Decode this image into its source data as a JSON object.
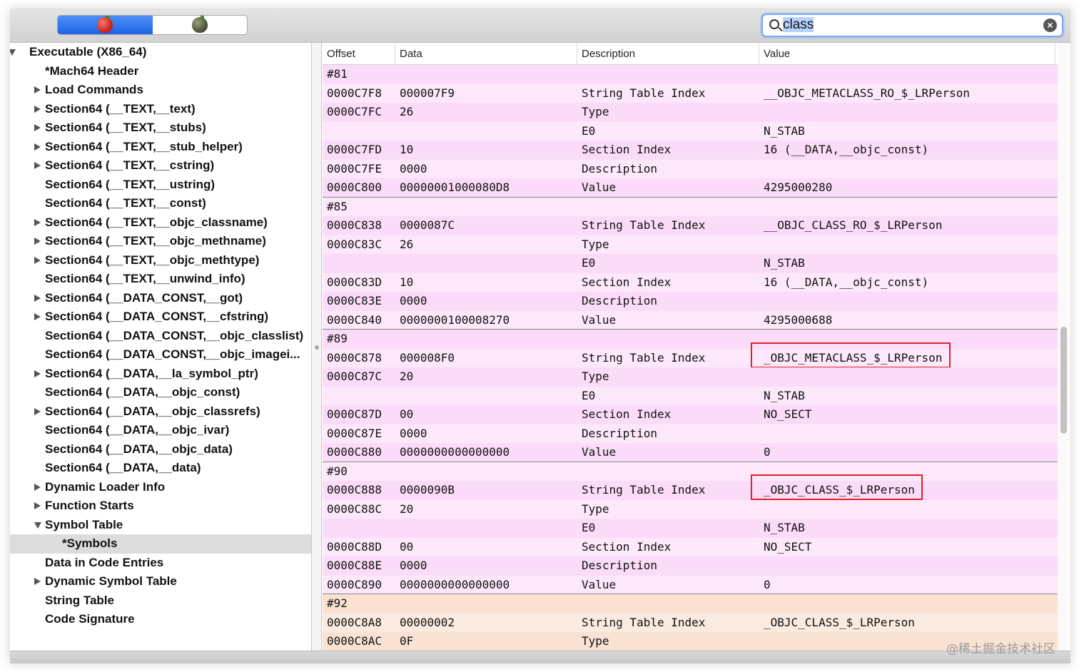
{
  "search": {
    "value": "class"
  },
  "sidebar": {
    "items": [
      {
        "label": "Executable  (X86_64)",
        "level": 0,
        "toggle": "down"
      },
      {
        "label": "*Mach64 Header",
        "level": 1,
        "toggle": "none"
      },
      {
        "label": "Load Commands",
        "level": 1,
        "toggle": "right"
      },
      {
        "label": "Section64 (__TEXT,__text)",
        "level": 1,
        "toggle": "right"
      },
      {
        "label": "Section64 (__TEXT,__stubs)",
        "level": 1,
        "toggle": "right"
      },
      {
        "label": "Section64 (__TEXT,__stub_helper)",
        "level": 1,
        "toggle": "right"
      },
      {
        "label": "Section64 (__TEXT,__cstring)",
        "level": 1,
        "toggle": "right"
      },
      {
        "label": "Section64 (__TEXT,__ustring)",
        "level": 1,
        "toggle": "none"
      },
      {
        "label": "Section64 (__TEXT,__const)",
        "level": 1,
        "toggle": "none"
      },
      {
        "label": "Section64 (__TEXT,__objc_classname)",
        "level": 1,
        "toggle": "right"
      },
      {
        "label": "Section64 (__TEXT,__objc_methname)",
        "level": 1,
        "toggle": "right"
      },
      {
        "label": "Section64 (__TEXT,__objc_methtype)",
        "level": 1,
        "toggle": "right"
      },
      {
        "label": "Section64 (__TEXT,__unwind_info)",
        "level": 1,
        "toggle": "none"
      },
      {
        "label": "Section64 (__DATA_CONST,__got)",
        "level": 1,
        "toggle": "right"
      },
      {
        "label": "Section64 (__DATA_CONST,__cfstring)",
        "level": 1,
        "toggle": "right"
      },
      {
        "label": "Section64 (__DATA_CONST,__objc_classlist)",
        "level": 1,
        "toggle": "none"
      },
      {
        "label": "Section64 (__DATA_CONST,__objc_imagei...",
        "level": 1,
        "toggle": "none"
      },
      {
        "label": "Section64 (__DATA,__la_symbol_ptr)",
        "level": 1,
        "toggle": "right"
      },
      {
        "label": "Section64 (__DATA,__objc_const)",
        "level": 1,
        "toggle": "none"
      },
      {
        "label": "Section64 (__DATA,__objc_classrefs)",
        "level": 1,
        "toggle": "right"
      },
      {
        "label": "Section64 (__DATA,__objc_ivar)",
        "level": 1,
        "toggle": "none"
      },
      {
        "label": "Section64 (__DATA,__objc_data)",
        "level": 1,
        "toggle": "none"
      },
      {
        "label": "Section64 (__DATA,__data)",
        "level": 1,
        "toggle": "none"
      },
      {
        "label": "Dynamic Loader Info",
        "level": 1,
        "toggle": "right"
      },
      {
        "label": "Function Starts",
        "level": 1,
        "toggle": "right"
      },
      {
        "label": "Symbol Table",
        "level": 1,
        "toggle": "down"
      },
      {
        "label": "*Symbols",
        "level": 2,
        "toggle": "none",
        "selected": true
      },
      {
        "label": "Data in Code Entries",
        "level": 1,
        "toggle": "none"
      },
      {
        "label": "Dynamic Symbol Table",
        "level": 1,
        "toggle": "right"
      },
      {
        "label": "String Table",
        "level": 1,
        "toggle": "none"
      },
      {
        "label": "Code Signature",
        "level": 1,
        "toggle": "none"
      }
    ]
  },
  "table": {
    "columns": [
      "Offset",
      "Data",
      "Description",
      "Value"
    ],
    "rows": [
      {
        "offset": "#81",
        "data": "",
        "desc": "",
        "value": "",
        "tone": "pink"
      },
      {
        "offset": "0000C7F8",
        "data": "000007F9",
        "desc": "String Table Index",
        "value": "__OBJC_METACLASS_RO_$_LRPerson",
        "tone": "pink"
      },
      {
        "offset": "0000C7FC",
        "data": "26",
        "desc": "Type",
        "value": "",
        "tone": "pink"
      },
      {
        "offset": "",
        "data": "",
        "desc": "E0",
        "value": "N_STAB",
        "tone": "pink"
      },
      {
        "offset": "0000C7FD",
        "data": "10",
        "desc": "Section Index",
        "value": "16 (__DATA,__objc_const)",
        "tone": "pink"
      },
      {
        "offset": "0000C7FE",
        "data": "0000",
        "desc": "Description",
        "value": "",
        "tone": "pink"
      },
      {
        "offset": "0000C800",
        "data": "00000001000080D8",
        "desc": "Value",
        "value": "4295000280",
        "tone": "pink",
        "end": true
      },
      {
        "offset": "#85",
        "data": "",
        "desc": "",
        "value": "",
        "tone": "pink"
      },
      {
        "offset": "0000C838",
        "data": "0000087C",
        "desc": "String Table Index",
        "value": "__OBJC_CLASS_RO_$_LRPerson",
        "tone": "pink"
      },
      {
        "offset": "0000C83C",
        "data": "26",
        "desc": "Type",
        "value": "",
        "tone": "pink"
      },
      {
        "offset": "",
        "data": "",
        "desc": "E0",
        "value": "N_STAB",
        "tone": "pink"
      },
      {
        "offset": "0000C83D",
        "data": "10",
        "desc": "Section Index",
        "value": "16 (__DATA,__objc_const)",
        "tone": "pink"
      },
      {
        "offset": "0000C83E",
        "data": "0000",
        "desc": "Description",
        "value": "",
        "tone": "pink"
      },
      {
        "offset": "0000C840",
        "data": "0000000100008270",
        "desc": "Value",
        "value": "4295000688",
        "tone": "pink",
        "end": true
      },
      {
        "offset": "#89",
        "data": "",
        "desc": "",
        "value": "",
        "tone": "pink"
      },
      {
        "offset": "0000C878",
        "data": "000008F0",
        "desc": "String Table Index",
        "value": "_OBJC_METACLASS_$_LRPerson",
        "tone": "pink",
        "highlight": true
      },
      {
        "offset": "0000C87C",
        "data": "20",
        "desc": "Type",
        "value": "",
        "tone": "pink"
      },
      {
        "offset": "",
        "data": "",
        "desc": "E0",
        "value": "N_STAB",
        "tone": "pink"
      },
      {
        "offset": "0000C87D",
        "data": "00",
        "desc": "Section Index",
        "value": "NO_SECT",
        "tone": "pink"
      },
      {
        "offset": "0000C87E",
        "data": "0000",
        "desc": "Description",
        "value": "",
        "tone": "pink"
      },
      {
        "offset": "0000C880",
        "data": "0000000000000000",
        "desc": "Value",
        "value": "0",
        "tone": "pink",
        "end": true
      },
      {
        "offset": "#90",
        "data": "",
        "desc": "",
        "value": "",
        "tone": "pink"
      },
      {
        "offset": "0000C888",
        "data": "0000090B",
        "desc": "String Table Index",
        "value": "_OBJC_CLASS_$_LRPerson",
        "tone": "pink",
        "highlight": true
      },
      {
        "offset": "0000C88C",
        "data": "20",
        "desc": "Type",
        "value": "",
        "tone": "pink"
      },
      {
        "offset": "",
        "data": "",
        "desc": "E0",
        "value": "N_STAB",
        "tone": "pink"
      },
      {
        "offset": "0000C88D",
        "data": "00",
        "desc": "Section Index",
        "value": "NO_SECT",
        "tone": "pink"
      },
      {
        "offset": "0000C88E",
        "data": "0000",
        "desc": "Description",
        "value": "",
        "tone": "pink"
      },
      {
        "offset": "0000C890",
        "data": "0000000000000000",
        "desc": "Value",
        "value": "0",
        "tone": "pink",
        "end": true
      },
      {
        "offset": "#92",
        "data": "",
        "desc": "",
        "value": "",
        "tone": "peach"
      },
      {
        "offset": "0000C8A8",
        "data": "00000002",
        "desc": "String Table Index",
        "value": "_OBJC_CLASS_$_LRPerson",
        "tone": "peach"
      },
      {
        "offset": "0000C8AC",
        "data": "0F",
        "desc": "Type",
        "value": "",
        "tone": "peach"
      }
    ]
  },
  "watermark": "@稀土掘金技术社区",
  "colors": {
    "accent": "#1e64e8",
    "highlight_border": "#e0202a",
    "row_pink": "#fbdcf8",
    "row_peach": "#f9e2d2"
  }
}
